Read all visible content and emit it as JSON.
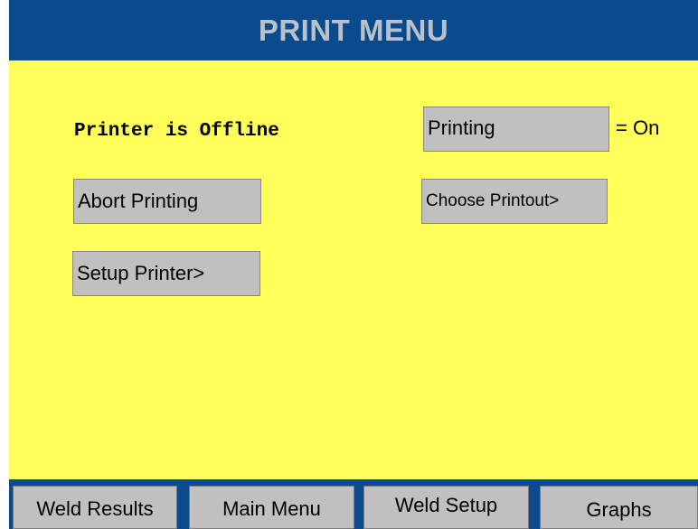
{
  "window": {
    "title": "PRINT MENU"
  },
  "main": {
    "printer_status": "Printer is Offline",
    "printing_button_label": "Printing",
    "printing_state": "= On",
    "abort_button_label": "Abort Printing",
    "choose_printout_button_label": "Choose Printout>",
    "setup_printer_button_label": "Setup Printer>"
  },
  "nav": {
    "items": [
      {
        "label": "Weld Results"
      },
      {
        "label": "Main Menu"
      },
      {
        "label": "Weld Setup"
      },
      {
        "label": "Graphs"
      }
    ]
  },
  "colors": {
    "header_bg": "#0b4a8c",
    "title_text": "#b9c2cc",
    "content_bg": "#ffff5a",
    "button_bg": "#c0c0c0"
  }
}
